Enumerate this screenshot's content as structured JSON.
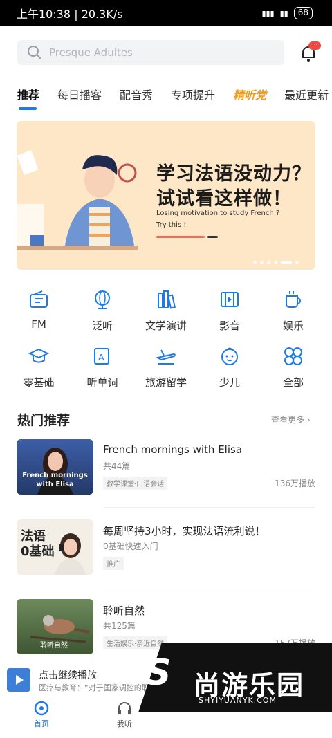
{
  "status": {
    "time": "上午10:38",
    "speed": "20.3K/s",
    "battery": "68"
  },
  "search": {
    "placeholder": "Presque Adultes"
  },
  "tabs": [
    "推荐",
    "每日播客",
    "配音秀",
    "专项提升",
    "精听党",
    "最近更新"
  ],
  "banner": {
    "line1": "学习法语没动力？",
    "line2": "试试看这样做！",
    "sub1": "Losing motivation to study French ?",
    "sub2": "Try this !"
  },
  "categories": [
    {
      "label": "FM",
      "icon": "radio-icon"
    },
    {
      "label": "泛听",
      "icon": "globe-icon"
    },
    {
      "label": "文学演讲",
      "icon": "books-icon"
    },
    {
      "label": "影音",
      "icon": "film-icon"
    },
    {
      "label": "娱乐",
      "icon": "cup-icon"
    },
    {
      "label": "零基础",
      "icon": "graduation-cap-icon"
    },
    {
      "label": "听单词",
      "icon": "word-card-icon"
    },
    {
      "label": "旅游留学",
      "icon": "airplane-icon"
    },
    {
      "label": "少儿",
      "icon": "child-face-icon"
    },
    {
      "label": "全部",
      "icon": "grid-icon"
    }
  ],
  "hot": {
    "title": "热门推荐",
    "more": "查看更多",
    "items": [
      {
        "title": "French mornings with Elisa",
        "sub": "共44篇",
        "tag": "教学课堂·口语会话",
        "plays": "136万播放",
        "thumb_text": "French mornings with Elisa"
      },
      {
        "title": "每周坚持3小时，实现法语流利说！",
        "sub": "0基础快速入门",
        "tag": "推广",
        "plays": "",
        "thumb_text": "法语 0基础"
      },
      {
        "title": "聆听自然",
        "sub": "共125篇",
        "tag": "生活娱乐·亲近自然",
        "plays": "157万播放",
        "thumb_text": "聆听自然"
      }
    ]
  },
  "mini_player": {
    "title": "点击继续播放",
    "sub": "医疗与教育：“对于国家调控的职业与领域，应该重塑一个有活力的劳动力市场”"
  },
  "nav": [
    {
      "label": "首页"
    },
    {
      "label": "我听"
    }
  ],
  "watermark": {
    "brand": "尚游乐园",
    "url": "SHYIYUANYK.COM",
    "letter": "S"
  },
  "colors": {
    "accent": "#1d7be8",
    "banner_bg": "#fde7c7",
    "special_tab": "#f29d1c"
  }
}
